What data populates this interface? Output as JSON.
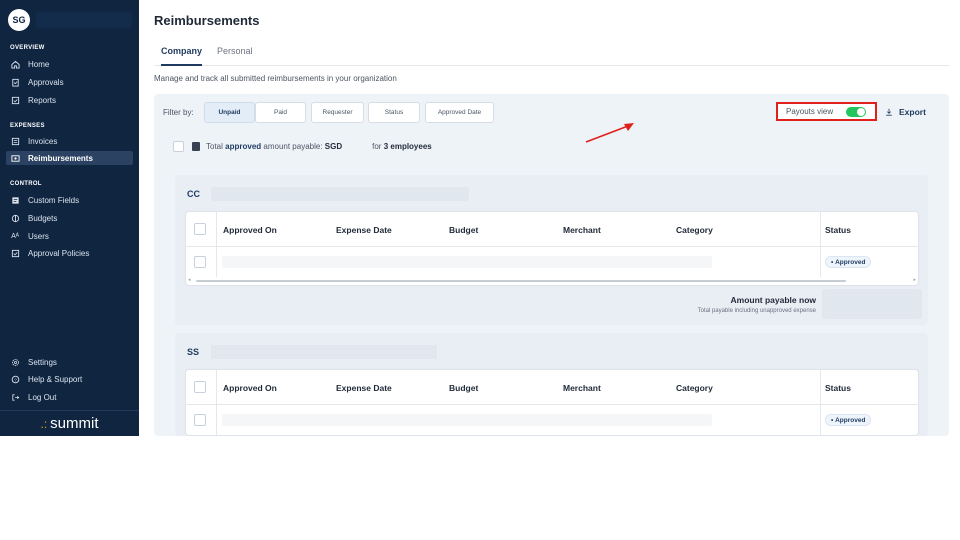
{
  "sidebar": {
    "avatar_initials": "SG",
    "sections": {
      "overview": "OVERVIEW",
      "expenses": "EXPENSES",
      "control": "CONTROL"
    },
    "items": [
      {
        "label": "Home",
        "icon": "home-icon"
      },
      {
        "label": "Approvals",
        "icon": "clipboard-icon"
      },
      {
        "label": "Reports",
        "icon": "checkbox-icon"
      },
      {
        "label": "Invoices",
        "icon": "invoice-icon"
      },
      {
        "label": "Reimbursements",
        "icon": "reimbursement-icon",
        "active": true
      },
      {
        "label": "Custom Fields",
        "icon": "custom-fields-icon"
      },
      {
        "label": "Budgets",
        "icon": "budget-icon"
      },
      {
        "label": "Users",
        "icon": "users-icon"
      },
      {
        "label": "Approval Policies",
        "icon": "policy-icon"
      },
      {
        "label": "Settings",
        "icon": "gear-icon"
      },
      {
        "label": "Help & Support",
        "icon": "help-icon"
      },
      {
        "label": "Log Out",
        "icon": "logout-icon"
      }
    ],
    "brand": "summit"
  },
  "main": {
    "title": "Reimbursements",
    "tabs": [
      "Company",
      "Personal"
    ],
    "subtitle": "Manage and track all submitted reimbursements in your organization",
    "filter": {
      "label": "Filter by:",
      "chips": [
        "Unpaid",
        "Paid",
        "Requester",
        "Status",
        "Approved Date"
      ],
      "selected": "Unpaid"
    },
    "payouts_view_label": "Payouts view",
    "payouts_view_on": true,
    "export_label": "Export",
    "total": {
      "prefix": "Total",
      "approved": "approved",
      "middle": "amount payable:",
      "currency": "SGD",
      "for": "for",
      "employees": "3 employees"
    },
    "columns": [
      "Approved On",
      "Expense Date",
      "Budget",
      "Merchant",
      "Category",
      "Status"
    ],
    "groups": [
      {
        "code": "CC",
        "status": "Approved",
        "amount_title": "Amount payable now",
        "amount_subtitle": "Total payable including unapproved expense"
      },
      {
        "code": "SS",
        "status": "Approved"
      }
    ]
  },
  "colors": {
    "sidebar_bg": "#0f2540",
    "accent": "#1e3a5f",
    "toggle_on": "#22c55e",
    "highlight": "#e0201a"
  }
}
